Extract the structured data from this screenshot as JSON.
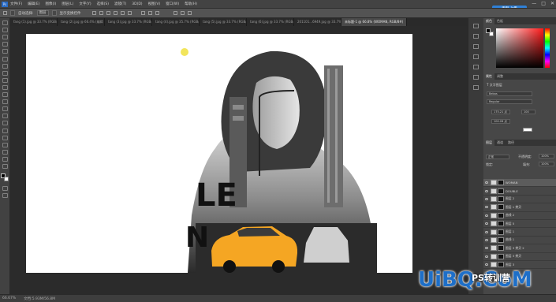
{
  "menubar": {
    "logo": "Ps",
    "items": [
      "文件(F)",
      "编辑(E)",
      "图像(I)",
      "图层(L)",
      "文字(Y)",
      "选择(S)",
      "滤镜(T)",
      "3D(D)",
      "视图(V)",
      "窗口(W)",
      "帮助(H)"
    ],
    "cloud_button": "无限 上传",
    "window_controls": [
      "—",
      "□",
      "✕"
    ]
  },
  "options": {
    "auto_select": "自动选择:",
    "target": "图层",
    "show_transform": "显示变换控件"
  },
  "tabs": [
    "fang (1).jpg @ 33.7% (RGB/8#)",
    "tang (2).jpg @ 66.4% (编辑 RGB/8#)",
    "tang (3).jpg @ 33.7% (RGB/8#)",
    "tang (4).jpg @ 35.7% (RGB/8#)",
    "tang (5).jpg @ 33.7% (RGB/8#)",
    "tang (6).jpg @ 33.7% (RGB/8#)",
    "201101...6949.jpg @ 33.7% (RGB/8#)",
    "未标题-1 @ 66.8% (WOMAN, RGB/8#)"
  ],
  "active_tab_index": 7,
  "canvas": {
    "letters": "LE",
    "letter2": "N"
  },
  "panel": {
    "tabs": [
      "颜色",
      "色板"
    ],
    "props_tabs": [
      "属性",
      "调整"
    ],
    "type_label": "文字图层",
    "font": "Bebas",
    "style": "Regular",
    "size1": "175.21 点",
    "size2": "100.26 点",
    "tracking": "100",
    "layers_tabs": [
      "图层",
      "通道",
      "路径"
    ],
    "blend": "正常",
    "opacity_label": "不透明度:",
    "opacity": "100%",
    "lock_label": "锁定:",
    "fill_label": "填充:",
    "fill": "100%",
    "layers": [
      {
        "name": "WOMAN",
        "sel": true
      },
      {
        "name": "DOUBLE",
        "sel": false
      },
      {
        "name": "图层 2",
        "sel": false
      },
      {
        "name": "图层 1 拷贝",
        "sel": false
      },
      {
        "name": "曲线 2",
        "sel": false
      },
      {
        "name": "图层 5",
        "sel": false
      },
      {
        "name": "图层 1",
        "sel": false
      },
      {
        "name": "曲线 1",
        "sel": false
      },
      {
        "name": "图层 3 拷贝 2",
        "sel": false
      },
      {
        "name": "图层 3 拷贝",
        "sel": false
      },
      {
        "name": "图层 3",
        "sel": false
      }
    ]
  },
  "status": {
    "zoom": "66.67%",
    "doc": "文档:5.93M/56.8M"
  },
  "watermark": {
    "text": "UiBQ.CoM",
    "sub": "PS转训营"
  },
  "colors": {
    "accent": "#2f80d6",
    "taxi": "#f5a623"
  }
}
